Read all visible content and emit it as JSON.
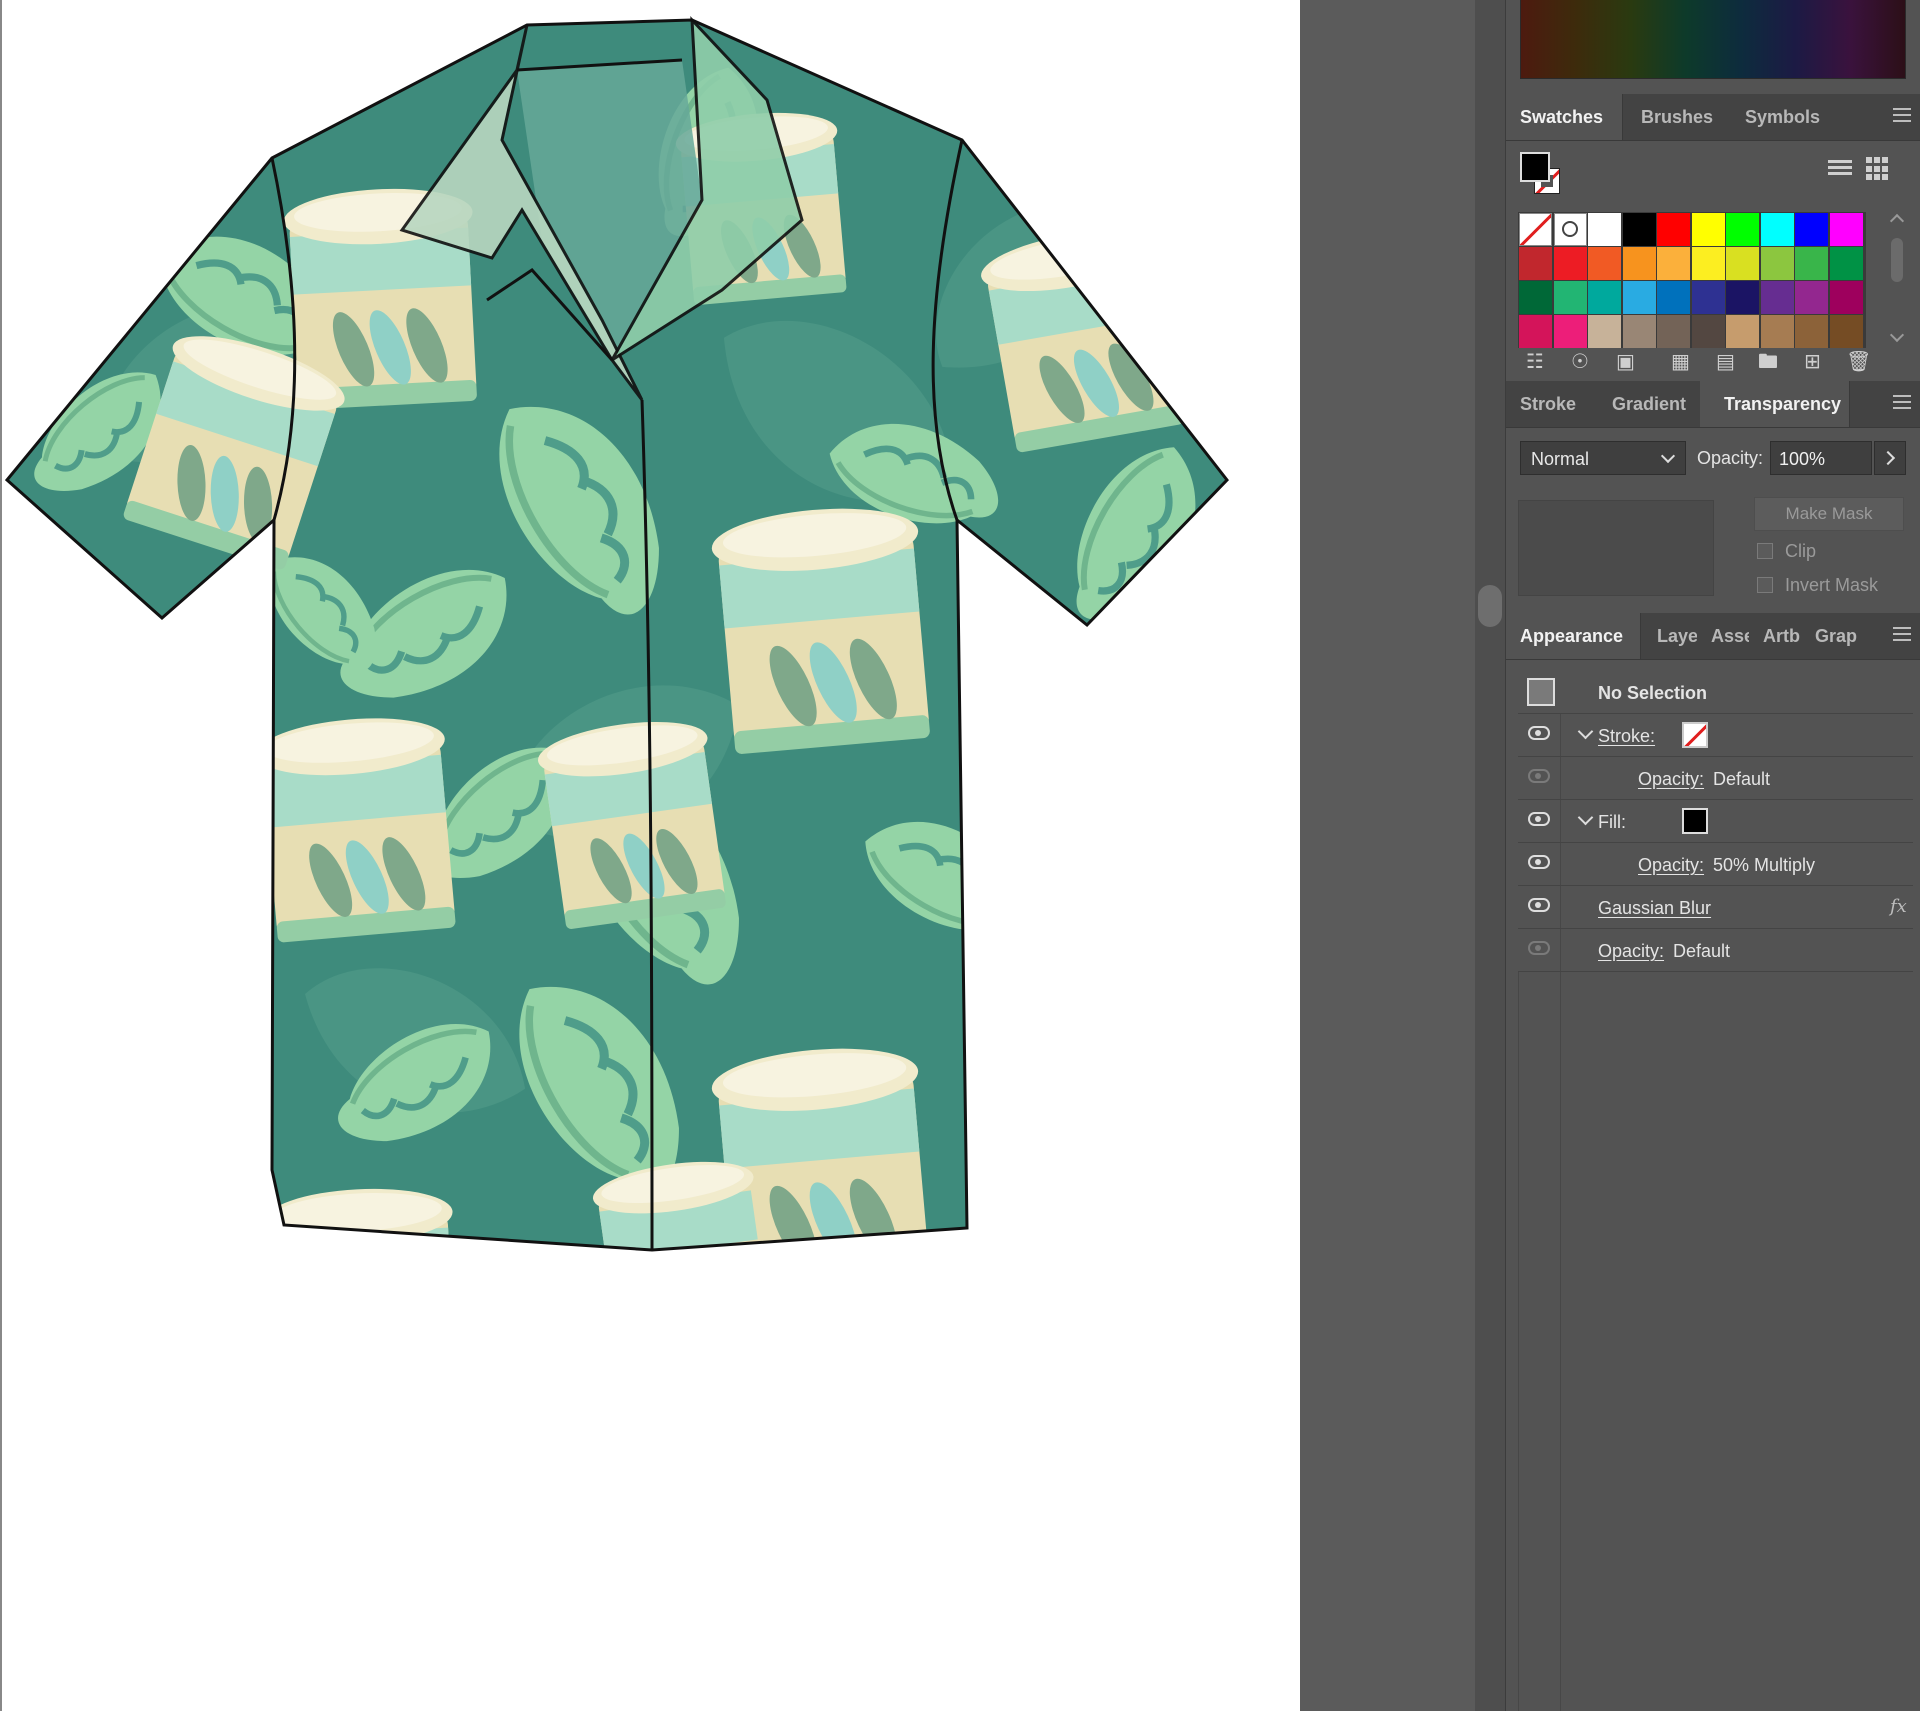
{
  "swatches_panel": {
    "tabs": [
      "Swatches",
      "Brushes",
      "Symbols"
    ],
    "active_tab": "Swatches",
    "colors": {
      "row1": [
        "none",
        "registration",
        "#ffffff",
        "#000000",
        "#ff0000",
        "#ffff00",
        "#00ff00",
        "#00ffff",
        "#0000ff",
        "#ff00ff"
      ],
      "row2": [
        "#c1272d",
        "#ed1c24",
        "#f15a24",
        "#f7931e",
        "#fbb03b",
        "#fcee21",
        "#d9e021",
        "#8cc63f",
        "#39b54a",
        "#009245"
      ],
      "row3": [
        "#006837",
        "#22b573",
        "#00a99d",
        "#29abe2",
        "#0071bc",
        "#2e3192",
        "#1b1464",
        "#662d91",
        "#93278f",
        "#9e005d"
      ],
      "row4": [
        "#d4145a",
        "#ed1e79",
        "#c7b299",
        "#998675",
        "#736357",
        "#534741",
        "#c69c6d",
        "#a67c52",
        "#8c6239",
        "#754c24"
      ]
    }
  },
  "transparency_panel": {
    "tabs": [
      "Stroke",
      "Gradient",
      "Transparency"
    ],
    "active_tab": "Transparency",
    "blend_mode": "Normal",
    "opacity_label": "Opacity:",
    "opacity_value": "100%",
    "make_mask": "Make Mask",
    "clip": "Clip",
    "invert_mask": "Invert Mask"
  },
  "appearance_panel": {
    "tabs": [
      "Appearance",
      "Laye",
      "Asse",
      "Artb",
      "Grap"
    ],
    "active_tab": "Appearance",
    "title": "No Selection",
    "rows": [
      {
        "label": "Stroke:",
        "value": ""
      },
      {
        "label": "Opacity:",
        "value": "Default"
      },
      {
        "label": "Fill:",
        "value": ""
      },
      {
        "label": "Opacity:",
        "value": "50% Multiply"
      },
      {
        "label": "Gaussian Blur",
        "value": "fx"
      },
      {
        "label": "Opacity:",
        "value": "Default"
      }
    ]
  },
  "colors": {
    "shirt_base": "#3e8b7c",
    "leaf_light": "#94d4a6",
    "leaf_dark": "#4f9d8a",
    "jar_cream": "#e7deb3",
    "jar_glass": "#a8dcc8",
    "panel_bg": "#535353"
  }
}
